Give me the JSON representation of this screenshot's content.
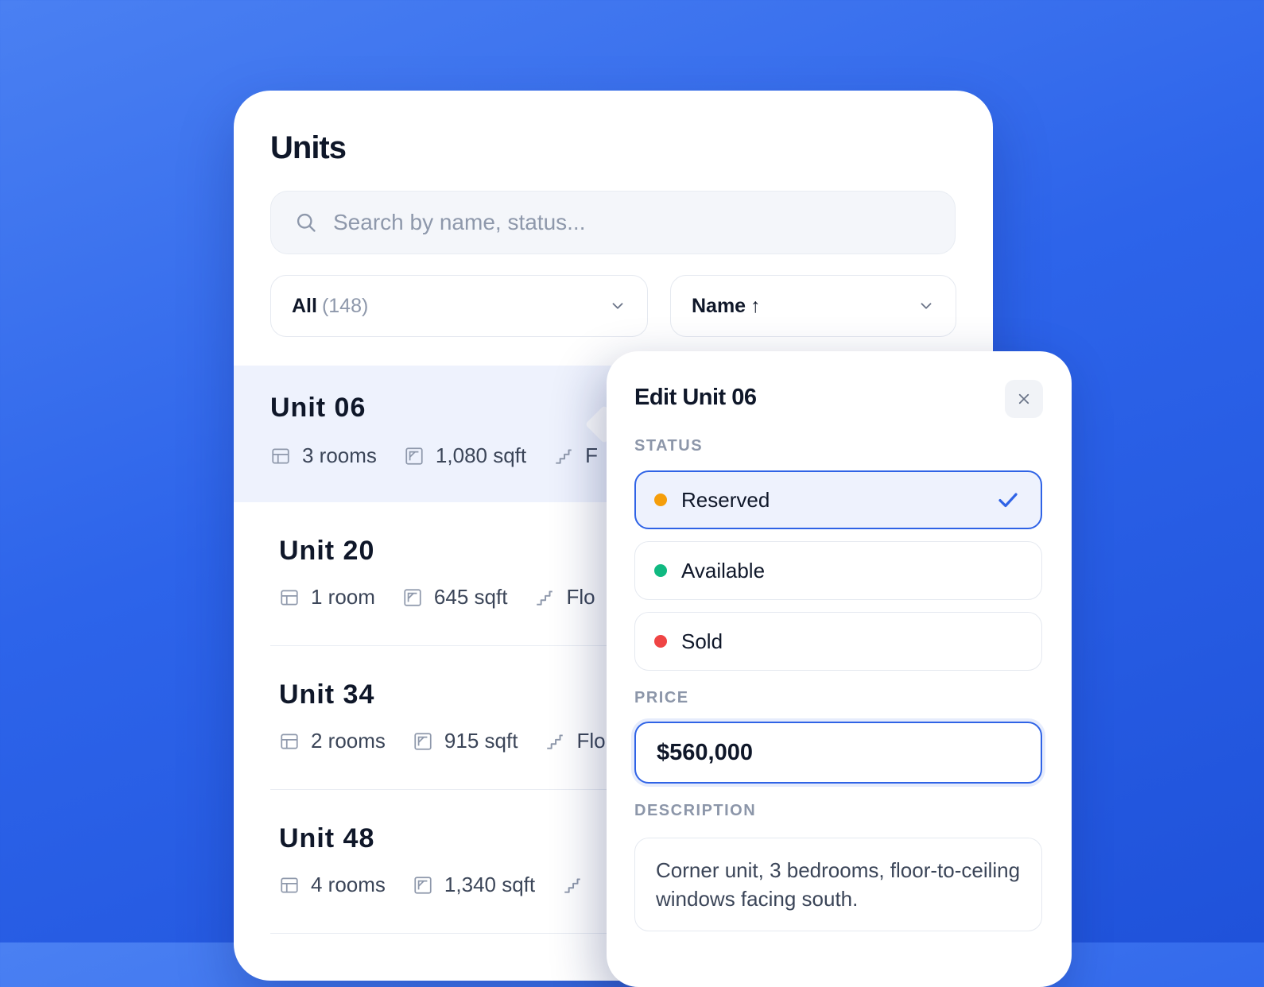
{
  "units_panel": {
    "title": "Units",
    "search": {
      "placeholder": "Search by name, status..."
    },
    "filter": {
      "value": "All",
      "count": "(148)"
    },
    "sort": {
      "value": "Name",
      "direction_symbol": "↑"
    }
  },
  "units": [
    {
      "name": "Unit 06",
      "rooms": "3 rooms",
      "area": "1,080 sqft",
      "floor": "F"
    },
    {
      "name": "Unit 20",
      "rooms": "1 room",
      "area": "645 sqft",
      "floor": "Flo"
    },
    {
      "name": "Unit 34",
      "rooms": "2 rooms",
      "area": "915 sqft",
      "floor": "Flo"
    },
    {
      "name": "Unit 48",
      "rooms": "4 rooms",
      "area": "1,340 sqft",
      "floor": ""
    }
  ],
  "edit_popover": {
    "title": "Edit Unit 06",
    "status_label": "STATUS",
    "status_options": [
      {
        "label": "Reserved",
        "color": "#f59e0b",
        "selected": true
      },
      {
        "label": "Available",
        "color": "#10b981",
        "selected": false
      },
      {
        "label": "Sold",
        "color": "#ef4444",
        "selected": false
      }
    ],
    "price_label": "PRICE",
    "price_value": "$560,000",
    "description_label": "DESCRIPTION",
    "description_value": "Corner unit, 3 bedrooms, floor-to-ceiling windows facing south."
  },
  "colors": {
    "background": "#2d64ea",
    "accent": "#2f63e6",
    "selected_row": "#eef2fd"
  },
  "icons": [
    "search-icon",
    "chevron-down-icon",
    "rooms-icon",
    "area-icon",
    "stairs-icon",
    "close-icon",
    "check-icon"
  ]
}
